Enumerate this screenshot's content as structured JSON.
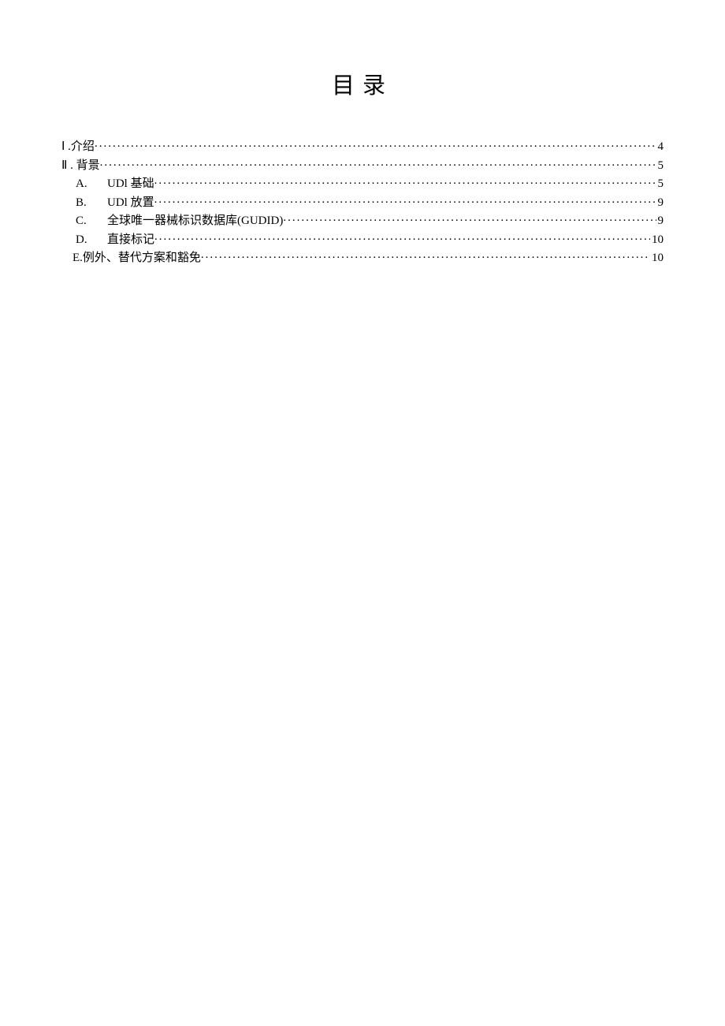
{
  "title": "目录",
  "toc": {
    "items": [
      {
        "label": "Ⅰ .介绍",
        "page": "4",
        "indent": 0
      },
      {
        "label": "Ⅱ . 背景 ",
        "page": "5",
        "indent": 0
      },
      {
        "letter": "A.",
        "text": "UDl 基础",
        "page": "5",
        "indent": 1
      },
      {
        "letter": "B.",
        "text": "UDl 放置",
        "page": "9",
        "indent": 1
      },
      {
        "letter": "C.",
        "text": "全球唯一器械标识数据库(GUDID)",
        "page": "9",
        "indent": 1
      },
      {
        "letter": "D.",
        "text": "直接标记",
        "page": "10",
        "indent": 1
      },
      {
        "label": "E.例外、替代方案和豁免",
        "page": "10",
        "indent": 1,
        "tight": true
      }
    ]
  }
}
